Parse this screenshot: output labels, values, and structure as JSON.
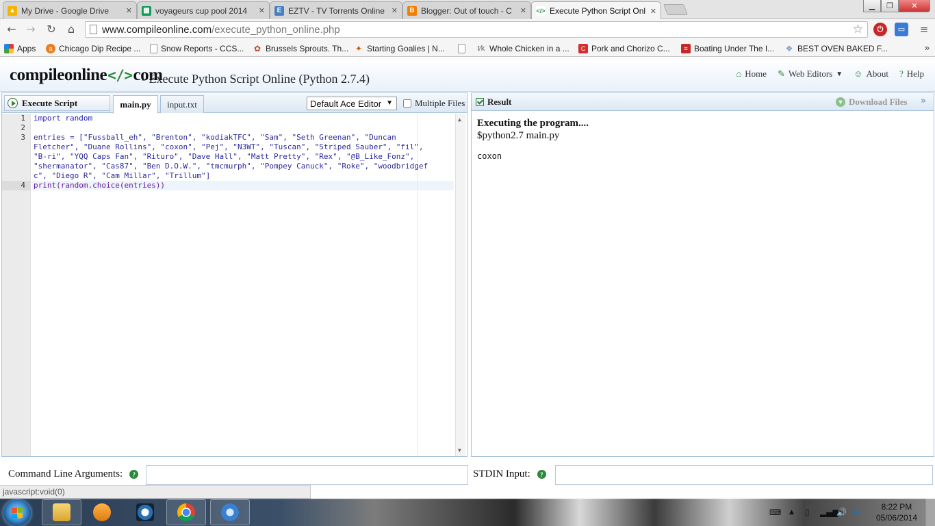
{
  "browser": {
    "tabs": [
      {
        "title": "My Drive - Google Drive",
        "icon": "google-drive-icon",
        "color": "#f4b400"
      },
      {
        "title": "voyageurs cup pool 2014",
        "icon": "google-sheets-icon",
        "color": "#0f9d58"
      },
      {
        "title": "EZTV - TV Torrents Online",
        "icon": "eztv-icon",
        "color": "#4a7fc0"
      },
      {
        "title": "Blogger: Out of touch - C",
        "icon": "blogger-icon",
        "color": "#f57d00"
      },
      {
        "title": "Execute Python Script Onl",
        "icon": "code-icon",
        "color": "#2e8b3a"
      }
    ],
    "url_host": "www.compileonline.com",
    "url_path": "/execute_python_online.php",
    "bookmarks": [
      {
        "label": "Apps",
        "icon": "apps-grid-icon"
      },
      {
        "label": "Chicago Dip Recipe ...",
        "icon": "recipe-icon"
      },
      {
        "label": "Snow Reports - CCS...",
        "icon": "page-icon"
      },
      {
        "label": "Brussels Sprouts. Th...",
        "icon": "sprout-icon"
      },
      {
        "label": "Starting Goalies | N...",
        "icon": "goalie-icon"
      },
      {
        "label": "",
        "icon": "page-icon"
      },
      {
        "label": "Whole Chicken in a ...",
        "icon": "chicken-icon"
      },
      {
        "label": "Pork and Chorizo C...",
        "icon": "c-red-icon"
      },
      {
        "label": "Boating Under The I...",
        "icon": "boat-icon"
      },
      {
        "label": "BEST OVEN BAKED F...",
        "icon": "bookmark-icon"
      }
    ]
  },
  "site": {
    "logo_left": "compileonline",
    "logo_glyph": "</>",
    "logo_right": "com",
    "subtitle": "- Execute Python Script Online (Python 2.7.4)",
    "nav": [
      {
        "label": "Home",
        "icon": "home-icon"
      },
      {
        "label": "Web Editors",
        "icon": "pencil-icon"
      },
      {
        "label": "About",
        "icon": "user-icon"
      },
      {
        "label": "Help",
        "icon": "help-icon"
      }
    ]
  },
  "editor_pane": {
    "execute_label": "Execute Script",
    "file_tabs": [
      "main.py",
      "input.txt"
    ],
    "active_tab": "main.py",
    "editor_mode": "Default Ace Editor",
    "multiple_files_label": "Multiple Files",
    "multiple_files_checked": false,
    "line_numbers": [
      "1",
      "2",
      "3",
      "4"
    ],
    "code_lines": [
      "import random",
      "",
      "entries = [\"Fussball_eh\", \"Brenton\", \"kodiakTFC\", \"Sam\", \"Seth Greenan\", \"Duncan",
      "Fletcher\", \"Duane Rollins\", \"coxon\", \"Pej\", \"N3WT\", \"Tuscan\", \"Striped Sauber\", \"fil\",",
      "\"B-ri\", \"YQQ Caps Fan\", \"Rituro\", \"Dave Hall\", \"Matt Pretty\", \"Rex\", \"@B_Like_Fonz\",",
      "\"shermanator\", \"Cas87\", \"Ben D.O.W.\", \"tmcmurph\", \"Pompey Canuck\", \"Roke\", \"woodbridgef",
      "c\", \"Diego R\", \"Cam Millar\", \"Trillum\"]",
      "print(random.choice(entries))"
    ]
  },
  "result_pane": {
    "title": "Result",
    "download_label": "Download Files",
    "output_header": "Executing the program....",
    "output_command": "$python2.7 main.py",
    "output_result": "coxon"
  },
  "bottom": {
    "cmd_args_label": "Command Line Arguments:",
    "stdin_label": "STDIN Input:",
    "cmd_args_value": "",
    "stdin_value": ""
  },
  "status_text": "javascript:void(0)",
  "taskbar": {
    "time": "8:22 PM",
    "date": "05/06/2014",
    "apps": [
      "file-explorer-icon",
      "media-player-icon",
      "snipping-tool-icon",
      "chrome-icon",
      "itunes-icon"
    ]
  }
}
